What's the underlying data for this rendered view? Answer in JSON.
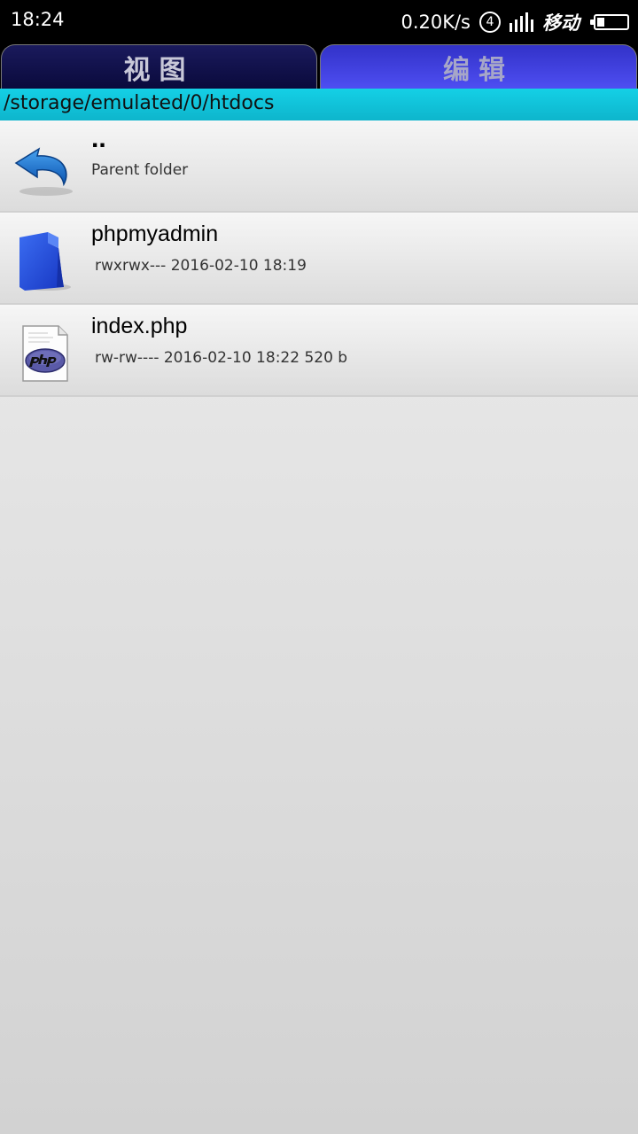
{
  "status_bar": {
    "time": "18:24",
    "network_speed": "0.20K/s",
    "sim_slot": "4",
    "carrier": "移动",
    "icons": {
      "signal": "signal-bars-icon",
      "battery": "battery-icon"
    }
  },
  "tabs": [
    {
      "label": "视图"
    },
    {
      "label": "编辑"
    }
  ],
  "path": "/storage/emulated/0/htdocs",
  "files": [
    {
      "name": "..",
      "meta": "Parent folder",
      "icon": "back-arrow-icon"
    },
    {
      "name": "phpmyadmin",
      "meta": "rwxrwx--- 2016-02-10 18:19",
      "icon": "folder-icon"
    },
    {
      "name": "index.php",
      "meta": "rw-rw---- 2016-02-10 18:22 520 b",
      "icon": "php-file-icon"
    }
  ]
}
